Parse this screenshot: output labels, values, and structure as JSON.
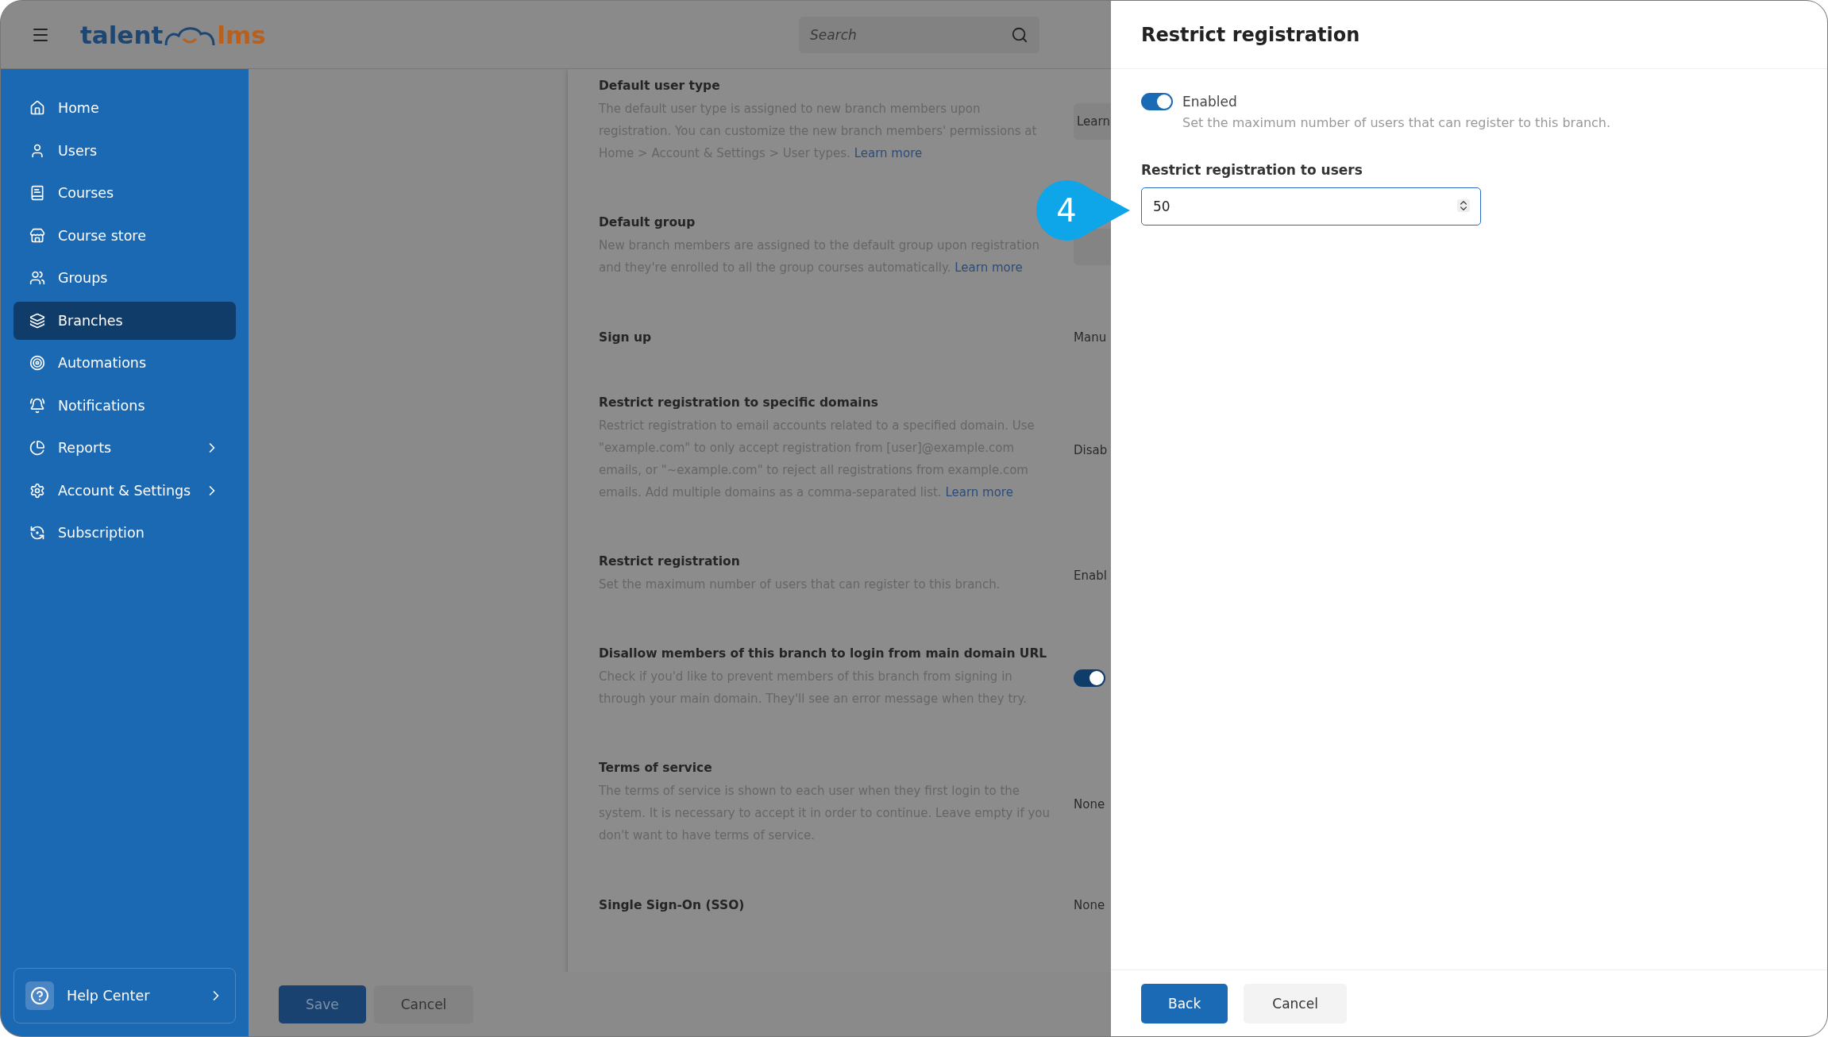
{
  "topbar": {
    "logo": {
      "left": "talent",
      "right": "lms"
    },
    "search": {
      "placeholder": "Search"
    }
  },
  "sidebar": {
    "items": [
      {
        "label": "Home",
        "selected": false,
        "submenu": false
      },
      {
        "label": "Users",
        "selected": false,
        "submenu": false
      },
      {
        "label": "Courses",
        "selected": false,
        "submenu": false
      },
      {
        "label": "Course store",
        "selected": false,
        "submenu": false
      },
      {
        "label": "Groups",
        "selected": false,
        "submenu": false
      },
      {
        "label": "Branches",
        "selected": true,
        "submenu": false
      },
      {
        "label": "Automations",
        "selected": false,
        "submenu": false
      },
      {
        "label": "Notifications",
        "selected": false,
        "submenu": false
      },
      {
        "label": "Reports",
        "selected": false,
        "submenu": true
      },
      {
        "label": "Account & Settings",
        "selected": false,
        "submenu": true
      },
      {
        "label": "Subscription",
        "selected": false,
        "submenu": false
      }
    ],
    "help": {
      "label": "Help Center"
    }
  },
  "settings": [
    {
      "title": "Default user type",
      "description": "The default user type is assigned to new branch members upon registration. You can customize the new branch members' permissions at Home > Account & Settings > User types.",
      "link": "Learn more",
      "kind": "button",
      "value": "Learn"
    },
    {
      "title": "Default group",
      "description": "New branch members are assigned to the default group upon registration and they're enrolled to all the group courses automatically.",
      "link": "Learn more",
      "kind": "button"
    },
    {
      "title": "Sign up",
      "kind": "text",
      "value": "Manu"
    },
    {
      "title": "Restrict registration to specific domains",
      "description": "Restrict registration to email accounts related to a specified domain. Use \"example.com\" to only accept registration from [user]@example.com emails, or \"~example.com\" to reject all registrations from example.com emails. Add multiple domains as a comma-separated list.",
      "link": "Learn more",
      "kind": "text",
      "value": "Disab"
    },
    {
      "title": "Restrict registration",
      "description": "Set the maximum number of users that can register to this branch.",
      "kind": "text",
      "value": "Enabl"
    },
    {
      "title": "Disallow members of this branch to login from main domain URL",
      "description": "Check if you'd like to prevent members of this branch from signing in through your main domain. They'll see an error message when they try.",
      "kind": "toggle",
      "on": true
    },
    {
      "title": "Terms of service",
      "description": "The terms of service is shown to each user when they first login to the system. It is necessary to accept it in order to continue. Leave empty if you don't want to have terms of service.",
      "kind": "text",
      "value": "None"
    },
    {
      "title": "Single Sign-On (SSO)",
      "kind": "text",
      "value": "None"
    }
  ],
  "footer": {
    "buttons": [
      "Save",
      "Cancel"
    ]
  },
  "callout": {
    "label": "4"
  },
  "drawer": {
    "title": "Restrict registration",
    "toggle": {
      "label": "Enabled",
      "on": true,
      "hint": "Set the maximum number of users that can register to this branch."
    },
    "field": {
      "label": "Restrict registration to users",
      "value": "50"
    },
    "buttons": [
      "Back",
      "Cancel"
    ]
  }
}
